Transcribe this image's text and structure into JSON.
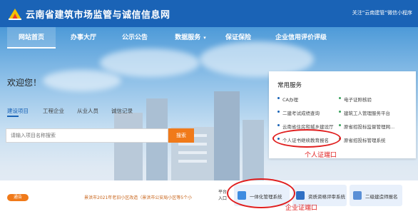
{
  "header": {
    "title": "云南省建筑市场监管与诚信信息网",
    "follow_text": "关注“云南建管”微信小程序"
  },
  "nav": {
    "items": [
      {
        "label": "网站首页"
      },
      {
        "label": "办事大厅"
      },
      {
        "label": "公示公告"
      },
      {
        "label": "数据服务"
      },
      {
        "label": "保证保险"
      },
      {
        "label": "企业信用评价评级"
      }
    ],
    "dropdown_arrow": "▾"
  },
  "welcome": "欢迎您！",
  "tabs": [
    "建设项目",
    "工程企业",
    "从业人员",
    "诚信记录"
  ],
  "search": {
    "placeholder": "请输入项目名称搜索",
    "button_label": "搜索"
  },
  "services_panel": {
    "title": "常用服务",
    "items": [
      {
        "label": "CA办理",
        "icon": "dot-blue"
      },
      {
        "label": "电子证照核验",
        "icon": "dot-green"
      },
      {
        "label": "二建考试成绩查询",
        "icon": "dot-blue"
      },
      {
        "label": "建筑工人管理服务平台",
        "icon": "dot-green"
      },
      {
        "label": "云南省住房和城乡建设厅",
        "icon": "dot-blue"
      },
      {
        "label": "原省招投标监督管理网...",
        "icon": "dot-green"
      },
      {
        "label": "个人证书继续教育报名",
        "icon": "dot-blue"
      },
      {
        "label": "原省招投标管理系统",
        "icon": "dot-green"
      }
    ]
  },
  "annotations": {
    "personal": "个人证端口",
    "enterprise": "企业证端口"
  },
  "bottom": {
    "notice_badge": "通告",
    "notice_text": "景洪市2021年老旧小区改造（景洪市公安局小区等5个小",
    "side_label": "平台入口",
    "systems": [
      {
        "label": "一体化管理系统",
        "icon": "cube-icon"
      },
      {
        "label": "资质资格评审系统",
        "icon": "handshake-icon"
      },
      {
        "label": "二级建造师报名",
        "icon": "person-icon"
      }
    ]
  },
  "colors": {
    "brand_blue": "#1a63b6",
    "accent_orange": "#f07a1a",
    "annotation_red": "#e01e1e"
  }
}
